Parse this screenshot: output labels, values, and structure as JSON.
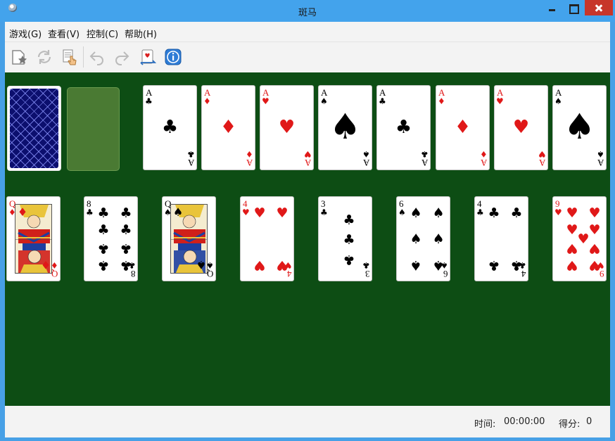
{
  "window": {
    "title": "斑马"
  },
  "menu": [
    {
      "id": "game",
      "label": "游戏(G)"
    },
    {
      "id": "view",
      "label": "查看(V)"
    },
    {
      "id": "control",
      "label": "控制(C)"
    },
    {
      "id": "help",
      "label": "帮助(H)"
    }
  ],
  "toolbar": [
    {
      "id": "new-game",
      "icon": "new-game-icon"
    },
    {
      "id": "restart",
      "icon": "restart-icon"
    },
    {
      "id": "select-game",
      "icon": "select-game-icon"
    },
    {
      "id": "undo",
      "icon": "undo-icon"
    },
    {
      "id": "redo",
      "icon": "redo-icon"
    },
    {
      "id": "hint",
      "icon": "hint-icon"
    },
    {
      "id": "info",
      "icon": "info-icon"
    }
  ],
  "colors": {
    "felt": "#0d4d14",
    "red_suit": "#e01818",
    "black_suit": "#000000",
    "card_back": "#0c0f6e"
  },
  "stock": {
    "face": "down"
  },
  "waste": {
    "empty": true
  },
  "foundations": [
    {
      "rank": "A",
      "suit": "♣",
      "color": "black"
    },
    {
      "rank": "A",
      "suit": "♦",
      "color": "red"
    },
    {
      "rank": "A",
      "suit": "♥",
      "color": "red"
    },
    {
      "rank": "A",
      "suit": "♠",
      "color": "black"
    },
    {
      "rank": "A",
      "suit": "♣",
      "color": "black"
    },
    {
      "rank": "A",
      "suit": "♦",
      "color": "red"
    },
    {
      "rank": "A",
      "suit": "♥",
      "color": "red"
    },
    {
      "rank": "A",
      "suit": "♠",
      "color": "black"
    }
  ],
  "tableau": [
    {
      "rank": "Q",
      "suit": "♦",
      "color": "red"
    },
    {
      "rank": "8",
      "suit": "♣",
      "color": "black"
    },
    {
      "rank": "Q",
      "suit": "♠",
      "color": "black"
    },
    {
      "rank": "4",
      "suit": "♥",
      "color": "red"
    },
    {
      "rank": "3",
      "suit": "♣",
      "color": "black"
    },
    {
      "rank": "6",
      "suit": "♠",
      "color": "black"
    },
    {
      "rank": "4",
      "suit": "♣",
      "color": "black"
    },
    {
      "rank": "9",
      "suit": "♥",
      "color": "red"
    }
  ],
  "status": {
    "time_label": "时间:",
    "time_value": "00:00:00",
    "score_label": "得分:",
    "score_value": "0"
  }
}
